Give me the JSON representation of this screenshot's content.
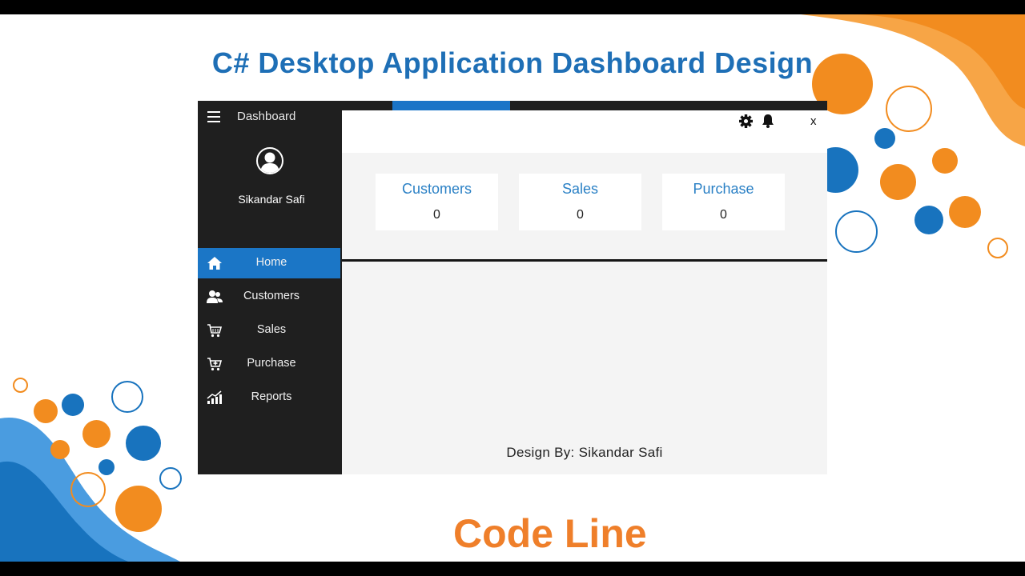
{
  "page": {
    "title": "C# Desktop Application Dashboard Design",
    "brand": "Code Line"
  },
  "colors": {
    "accent_blue": "#1b76c6",
    "sidebar_bg": "#1f1f1f",
    "brand_orange": "#ef7f2a",
    "title_blue": "#1e6fb6"
  },
  "app": {
    "sidebar": {
      "header_label": "Dashboard",
      "menu_icon": "hamburger-icon",
      "user_name": "Sikandar Safi",
      "avatar_icon": "user-avatar-icon",
      "items": [
        {
          "label": "Home",
          "icon": "home-icon",
          "active": true
        },
        {
          "label": "Customers",
          "icon": "users-icon",
          "active": false
        },
        {
          "label": "Sales",
          "icon": "cart-icon",
          "active": false
        },
        {
          "label": "Purchase",
          "icon": "cart-add-icon",
          "active": false
        },
        {
          "label": "Reports",
          "icon": "bar-chart-icon",
          "active": false
        }
      ]
    },
    "topbar": {
      "settings_icon": "gear-icon",
      "notifications_icon": "bell-icon",
      "close_label": "x"
    },
    "cards": [
      {
        "title": "Customers",
        "value": "0"
      },
      {
        "title": "Sales",
        "value": "0"
      },
      {
        "title": "Purchase",
        "value": "0"
      }
    ],
    "footer_credit": "Design By: Sikandar Safi"
  }
}
